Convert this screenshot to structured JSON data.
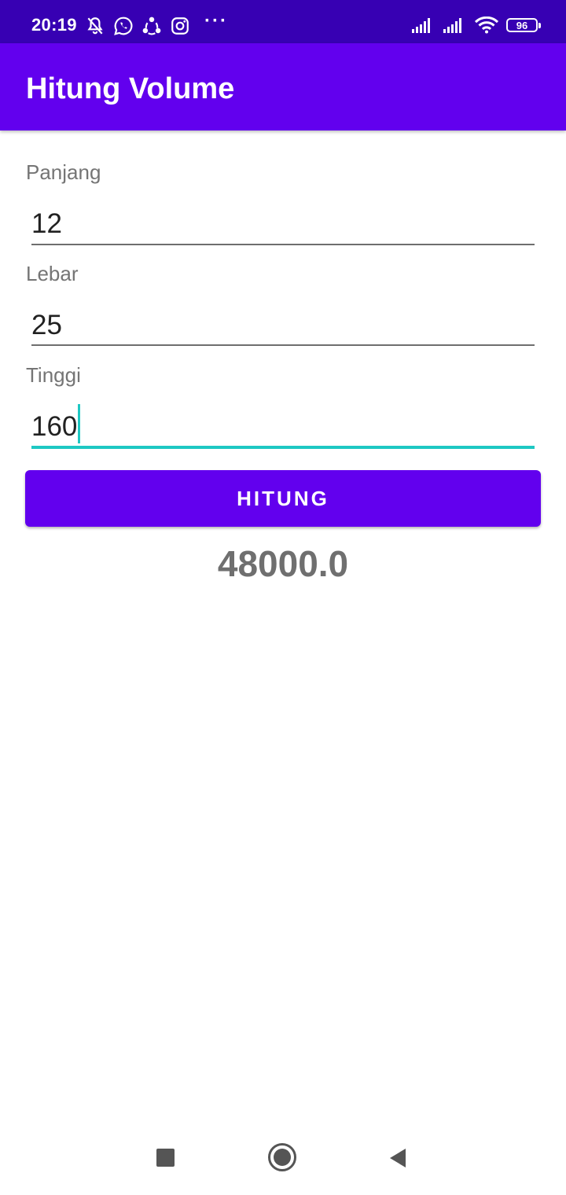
{
  "status_bar": {
    "time": "20:19",
    "battery": "96",
    "left_icons": [
      "bell-off-icon",
      "whatsapp-icon",
      "share-icon",
      "instagram-icon"
    ],
    "more": "···",
    "right_icons": [
      "signal-icon",
      "signal-icon",
      "wifi-icon",
      "battery-icon"
    ]
  },
  "app_bar": {
    "title": "Hitung Volume",
    "color": "#6200ee"
  },
  "form": {
    "panjang": {
      "label": "Panjang",
      "value": "12"
    },
    "lebar": {
      "label": "Lebar",
      "value": "25"
    },
    "tinggi": {
      "label": "Tinggi",
      "value": "160"
    }
  },
  "button": {
    "label": "HITUNG"
  },
  "result": "48000.0",
  "nav_bar": {
    "icons": [
      "recents-square-icon",
      "home-circle-icon",
      "back-triangle-icon"
    ]
  },
  "colors": {
    "status_bar": "#3700b3",
    "accent": "#1ec8c3",
    "primary": "#6200ee"
  }
}
